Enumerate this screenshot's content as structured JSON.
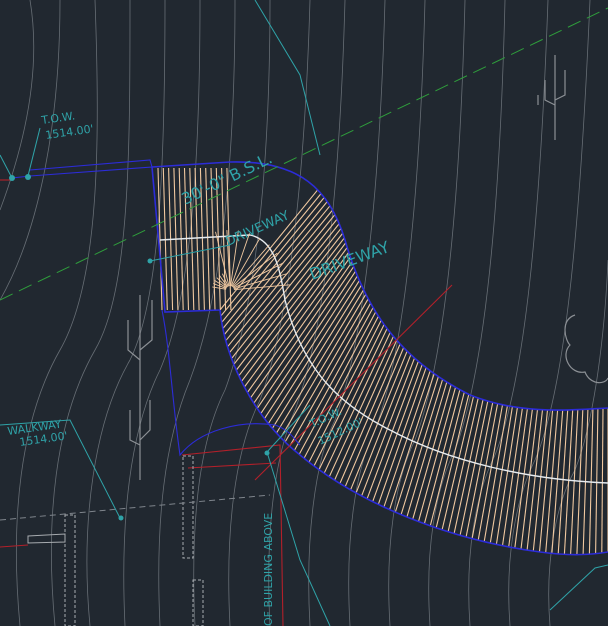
{
  "labels": {
    "tow_top": "T.O.W.",
    "tow_top_elev": "1514.00'",
    "setback": "30'-0\" B.S.L.",
    "driveway_main": "DRIVEWAY",
    "driveway_small": "DRIVEWAY",
    "walkway": "WALKWAY",
    "walkway_elev": "1514.00'",
    "tow_mid": "T.O.W.",
    "tow_mid_elev": "1512.00'",
    "building_above": "OF BUILDING ABOVE"
  },
  "colors": {
    "background": "#212830",
    "contour": "#7f858c",
    "driveway_edge": "#2c2cd8",
    "centerline": "#e6ebef",
    "hatch": "#f0c8a0",
    "setback_line": "#2f9e3c",
    "leader": "#2fa3a8",
    "annotation_text": "#2fa3a8",
    "grid_red": "#b3202a",
    "wall": "#a8acb0",
    "tree_symbol": "#8c9095"
  }
}
